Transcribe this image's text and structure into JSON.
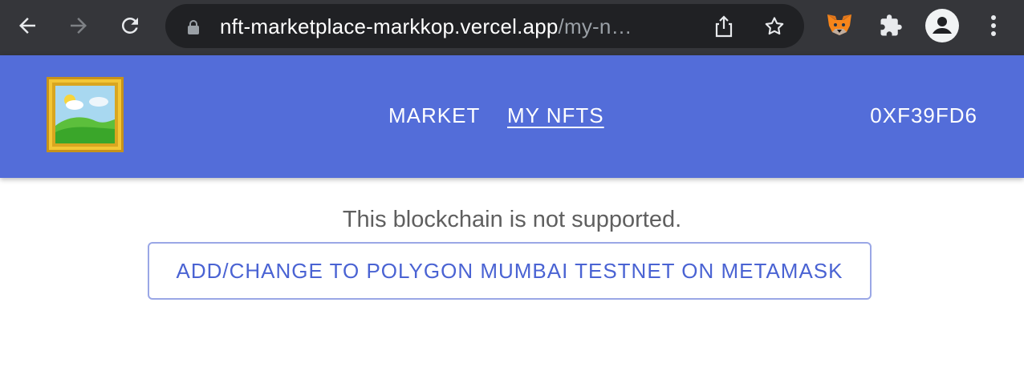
{
  "browser": {
    "url_host": "nft-marketplace-markkop.vercel.app",
    "url_path": "/my-n…",
    "icons": {
      "back": "arrow-left-icon",
      "forward": "arrow-right-icon",
      "reload": "reload-icon",
      "lock": "lock-icon",
      "share": "share-icon",
      "bookmark": "star-icon",
      "extension_metamask": "metamask-fox-icon",
      "extensions": "puzzle-icon",
      "profile": "profile-icon",
      "menu": "kebab-menu-icon"
    }
  },
  "appbar": {
    "background_color": "#536dd9",
    "logo_icon": "framed-picture-icon",
    "nav": [
      {
        "label": "MARKET"
      },
      {
        "label": "MY NFTS"
      }
    ],
    "account_label": "0XF39FD6"
  },
  "main": {
    "message": "This blockchain is not supported.",
    "action_button_label": "ADD/CHANGE TO POLYGON MUMBAI TESTNET ON METAMASK",
    "accent_color": "#4a63d3"
  }
}
